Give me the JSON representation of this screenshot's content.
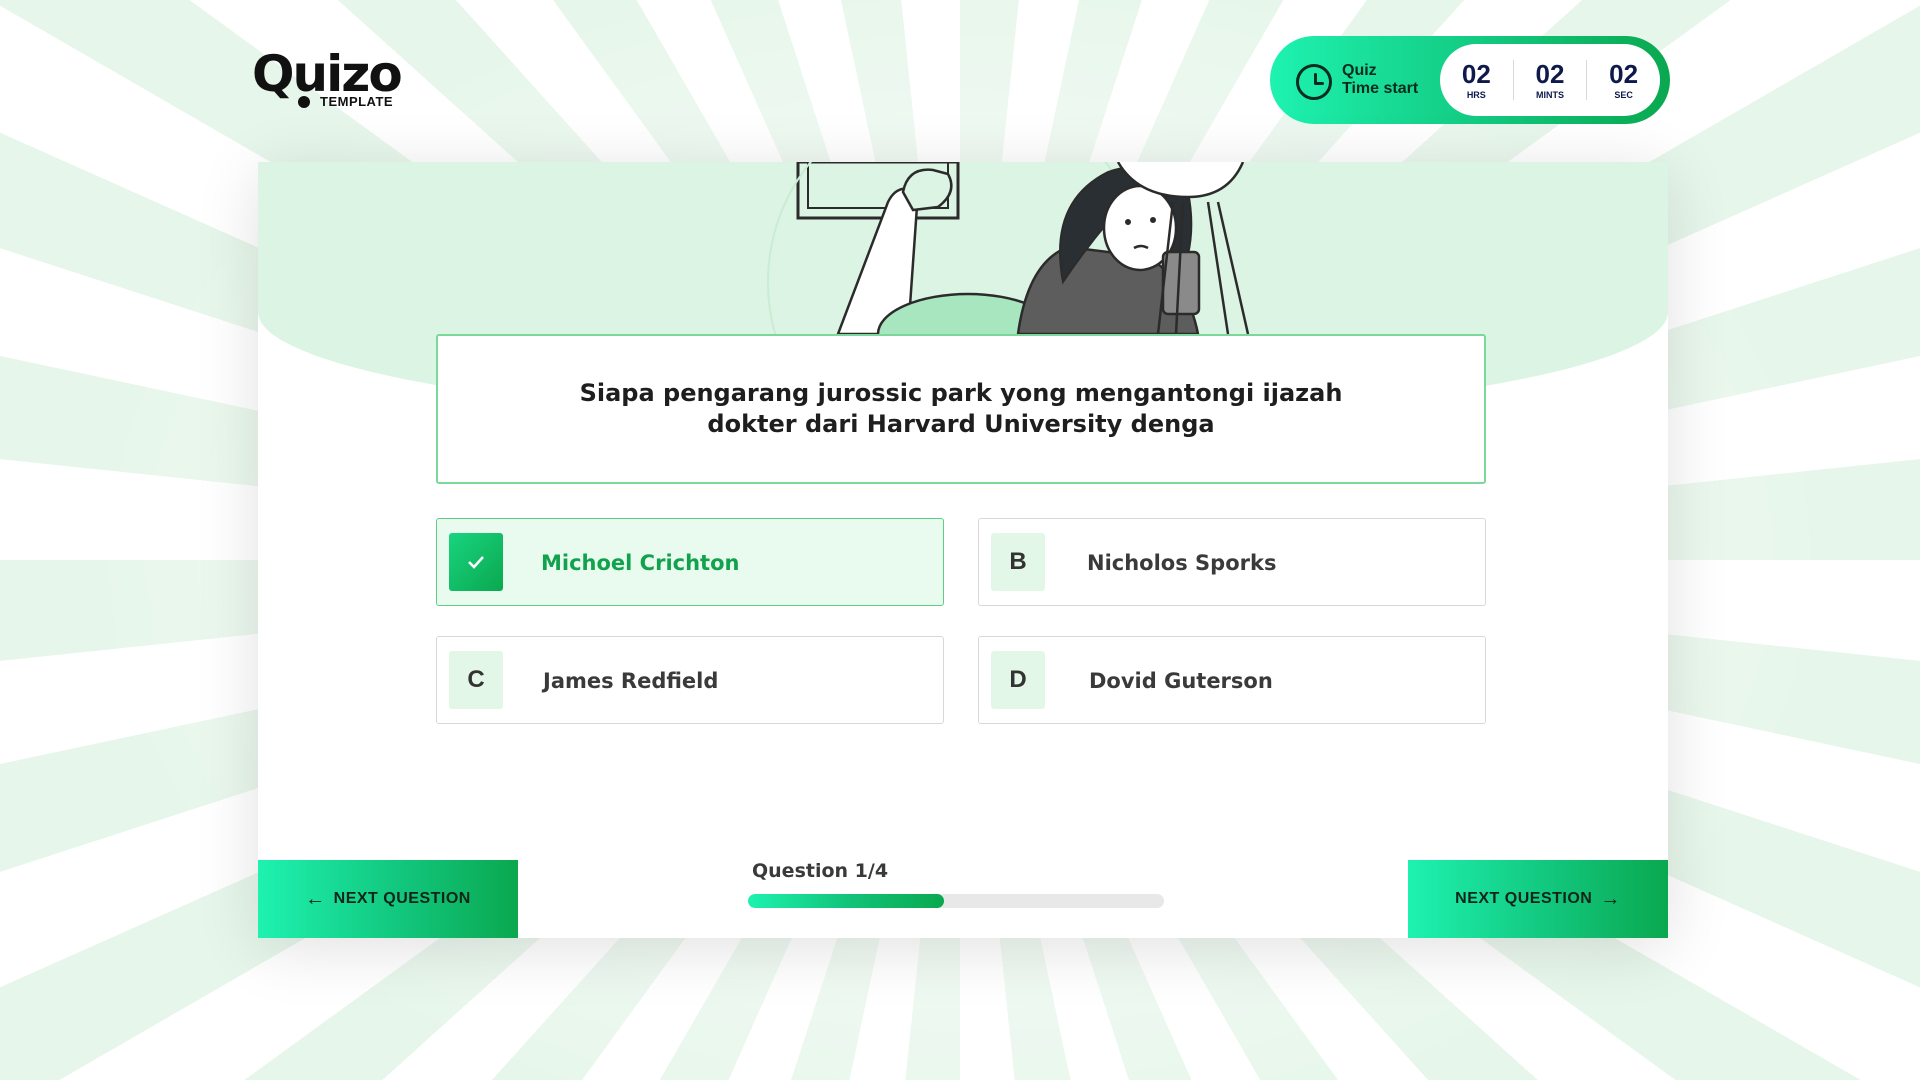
{
  "brand": {
    "logo_text": "Quizo",
    "logo_sub": "TEMPLATE"
  },
  "timer": {
    "label_line1": "Quiz",
    "label_line2": "Time start",
    "hours": "02",
    "hours_label": "HRS",
    "minutes": "02",
    "minutes_label": "MINTS",
    "seconds": "02",
    "seconds_label": "SEC"
  },
  "question": {
    "text": "Siapa pengarang jurossic park yong mengantongi ijazah dokter dari Harvard University denga"
  },
  "options": [
    {
      "key": "A",
      "label": "Michoel Crichton",
      "selected": true
    },
    {
      "key": "B",
      "label": "Nicholos Sporks",
      "selected": false
    },
    {
      "key": "C",
      "label": "James Redfield",
      "selected": false
    },
    {
      "key": "D",
      "label": "Dovid Guterson",
      "selected": false
    }
  ],
  "progress": {
    "label": "Question 1/4",
    "fraction": 0.47
  },
  "nav": {
    "prev_label": "NEXT QUESTION",
    "next_label": "NEXT QUESTION"
  },
  "colors": {
    "accent": "#11c47a",
    "accent_light": "#1ef2b0",
    "accent_dark": "#0aa84f",
    "hero_bg": "#dcf4e3",
    "selected_text": "#12a24e"
  }
}
